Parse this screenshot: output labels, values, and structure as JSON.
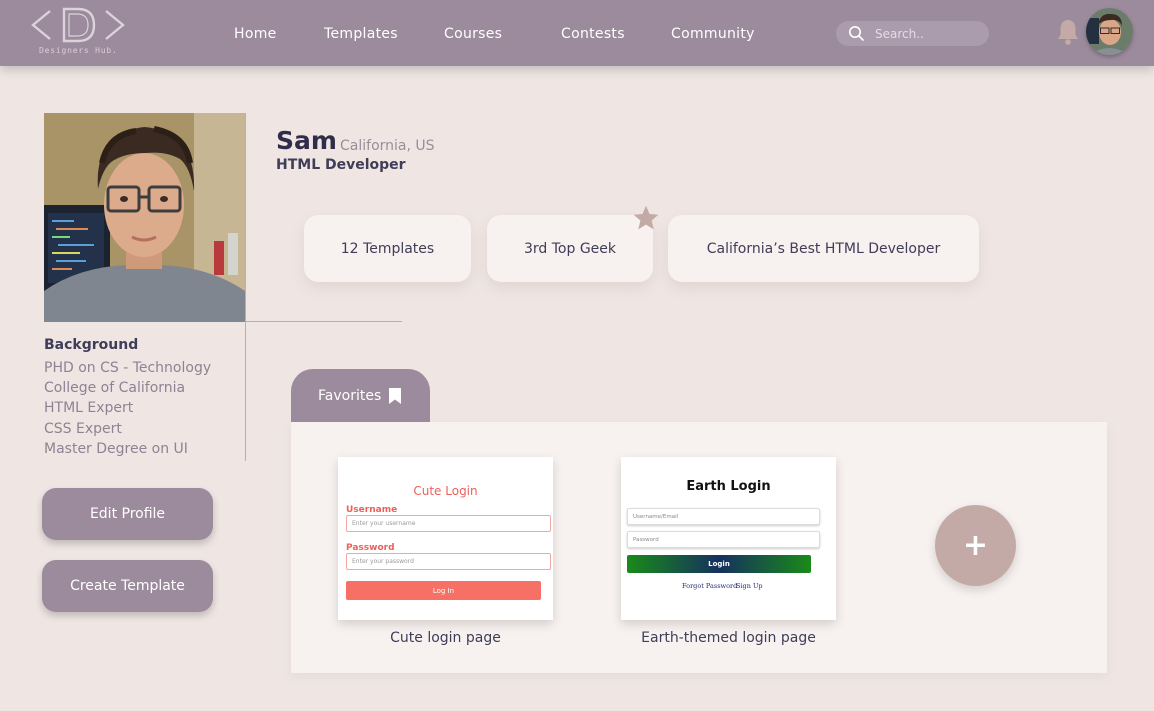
{
  "brand": {
    "mark": "<D>",
    "name": "Designers Hub."
  },
  "nav": {
    "links": [
      "Home",
      "Templates",
      "Courses",
      "Contests",
      "Community"
    ],
    "search_placeholder": "Search.."
  },
  "profile": {
    "name": "Sam",
    "location": "California, US",
    "role": "HTML Developer",
    "background_title": "Background",
    "background": [
      "PHD on CS - Technology",
      "College of California",
      "HTML Expert",
      "CSS Expert",
      "Master Degree on UI"
    ],
    "buttons": {
      "edit": "Edit Profile",
      "create": "Create Template"
    }
  },
  "stats": [
    "12 Templates",
    "3rd Top Geek",
    "California’s Best HTML Developer"
  ],
  "favorites": {
    "tab_label": "Favorites",
    "cards": [
      {
        "caption": "Cute login page",
        "title": "Cute Login",
        "username_label": "Username",
        "username_placeholder": "Enter your username",
        "password_label": "Password",
        "password_placeholder": "Enter your password",
        "button": "Log In"
      },
      {
        "caption": "Earth-themed login page",
        "title": "Earth Login",
        "username_placeholder": "Username/Email",
        "password_placeholder": "Password",
        "button": "Login",
        "forgot_link": "Forgot Password",
        "signup_link": "Sign Up"
      }
    ],
    "add_label": "+"
  },
  "colors": {
    "topbar": "#9c8b9d",
    "page_bg": "#efe6e3",
    "panel_bg": "#f7f1ef",
    "accent_rose": "#c4aaa6",
    "cute_red": "#ee5f5a"
  },
  "icons": {
    "search": "magnifier-icon",
    "notifications": "bell-icon",
    "favorites": "bookmark-icon",
    "badge": "star-icon",
    "add": "plus-icon"
  }
}
